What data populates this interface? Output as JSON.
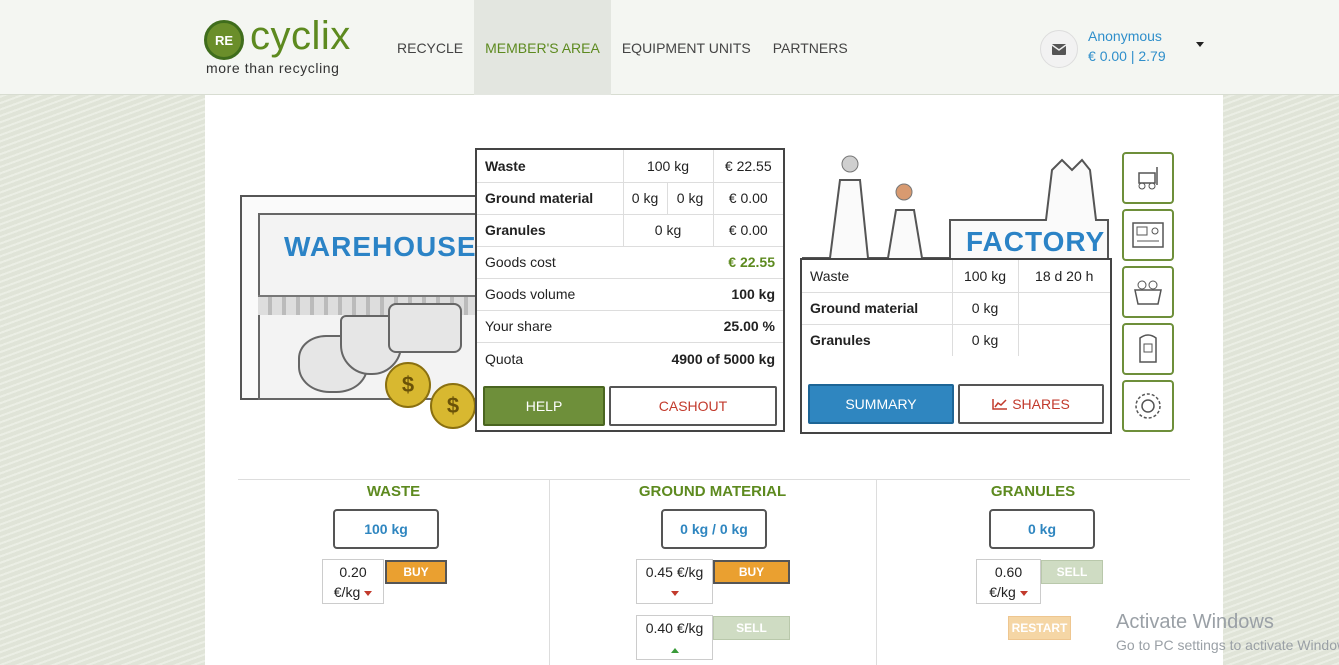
{
  "brand": {
    "logo_badge": "RE",
    "name": "cyclix",
    "tagline": "more than recycling",
    "accent_color": "#5d8a1f",
    "link_color": "#2f86c0"
  },
  "nav": {
    "items": [
      {
        "label": "RECYCLE",
        "active": false
      },
      {
        "label": "MEMBER'S AREA",
        "active": true
      },
      {
        "label": "EQUIPMENT UNITS",
        "active": false
      },
      {
        "label": "PARTNERS",
        "active": false
      }
    ]
  },
  "user": {
    "name": "Anonymous",
    "currency": "€",
    "balance_primary": "0.00",
    "balance_separator": "|",
    "balance_secondary": "2.79"
  },
  "warehouse": {
    "sign": "WAREHOUSE",
    "rows": [
      {
        "label": "Waste",
        "qty": "100 kg",
        "value": "€ 22.55"
      },
      {
        "label": "Ground material",
        "qty_a": "0 kg",
        "qty_b": "0 kg",
        "value": "€ 0.00"
      },
      {
        "label": "Granules",
        "qty": "0 kg",
        "value": "€ 0.00"
      }
    ],
    "stats": [
      {
        "label": "Goods cost",
        "value": "€ 22.55",
        "green": true
      },
      {
        "label": "Goods volume",
        "value": "100 kg",
        "green": false
      },
      {
        "label": "Your share",
        "value": "25.00 %",
        "green": false
      },
      {
        "label": "Quota",
        "value": "4900 of 5000 kg",
        "green": false
      }
    ],
    "help_label": "HELP",
    "cashout_label": "CASHOUT"
  },
  "factory": {
    "sign": "FACTORY",
    "rows": [
      {
        "label": "Waste",
        "qty": "100 kg",
        "time": "18 d 20 h"
      },
      {
        "label": "Ground material",
        "qty": "0 kg",
        "time": ""
      },
      {
        "label": "Granules",
        "qty": "0 kg",
        "time": ""
      }
    ],
    "summary_label": "SUMMARY",
    "shares_label": "SHARES"
  },
  "equipment": [
    "forklift-icon",
    "control-panel-icon",
    "shredder-icon",
    "granulator-icon",
    "gear-machine-icon"
  ],
  "market": {
    "waste": {
      "title": "WASTE",
      "qty": "100 kg",
      "buy_price": "0.20",
      "buy_unit": "€/kg",
      "buy_label": "BUY"
    },
    "ground": {
      "title": "GROUND MATERIAL",
      "qty": "0 kg / 0 kg",
      "buy_price": "0.45 €/kg",
      "buy_label": "BUY",
      "sell_price": "0.40 €/kg",
      "sell_label": "SELL"
    },
    "granules": {
      "title": "GRANULES",
      "qty": "0 kg",
      "sell_price": "0.60",
      "sell_unit": "€/kg",
      "sell_label": "SELL",
      "restart_label": "RESTART"
    }
  },
  "os_watermark": {
    "title": "Activate Windows",
    "subtitle": "Go to PC settings to activate Windows."
  }
}
